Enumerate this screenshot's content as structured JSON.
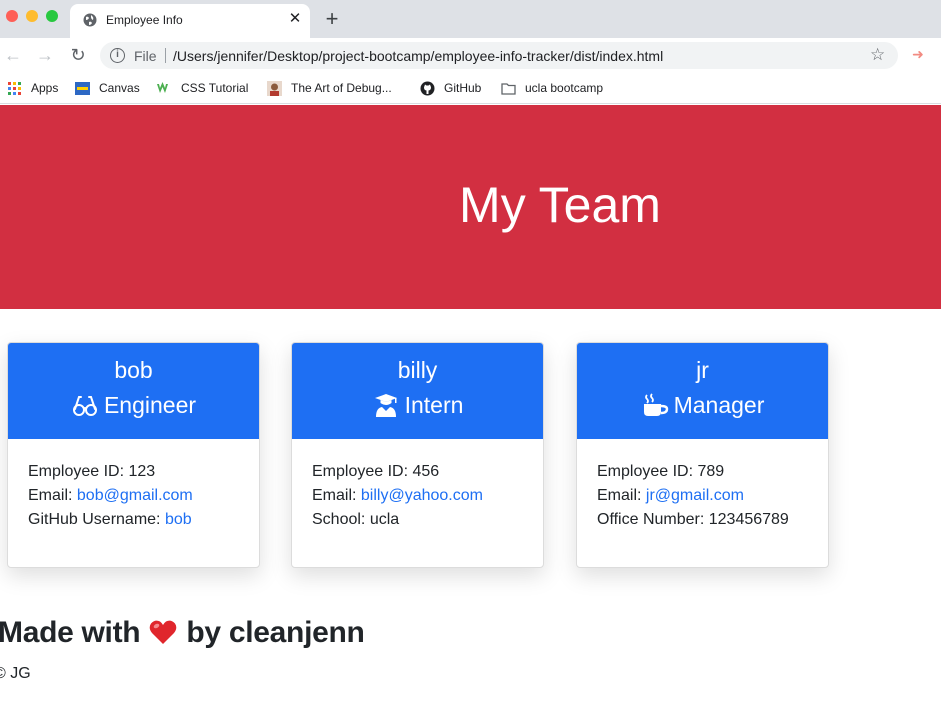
{
  "browser": {
    "tab_title": "Employee Info",
    "tab_close": "✕",
    "new_tab": "+",
    "file_label": "File",
    "url": "/Users/jennifer/Desktop/project-bootcamp/employee-info-tracker/dist/index.html",
    "bookmarks": [
      {
        "label": "Apps",
        "icon": "apps-grid-icon"
      },
      {
        "label": "Canvas",
        "icon": "ucla-icon"
      },
      {
        "label": "CSS Tutorial",
        "icon": "w3schools-icon"
      },
      {
        "label": "The Art of Debug...",
        "icon": "avatar-icon"
      },
      {
        "label": "GitHub",
        "icon": "github-icon"
      },
      {
        "label": "ucla bootcamp",
        "icon": "folder-icon"
      }
    ]
  },
  "header": {
    "title": "My Team"
  },
  "employees": [
    {
      "name": "bob",
      "role": "Engineer",
      "role_icon": "glasses-icon",
      "id_label": "Employee ID: 123",
      "email_label": "Email: ",
      "email": "bob@gmail.com",
      "extra_label": "GitHub Username: ",
      "extra_value": "bob"
    },
    {
      "name": "billy",
      "role": "Intern",
      "role_icon": "graduate-icon",
      "id_label": "Employee ID: 456",
      "email_label": "Email: ",
      "email": "billy@yahoo.com",
      "extra_label": "School: ucla",
      "extra_value": ""
    },
    {
      "name": "jr",
      "role": "Manager",
      "role_icon": "mug-icon",
      "id_label": "Employee ID: 789",
      "email_label": "Email: ",
      "email": "jr@gmail.com",
      "extra_label": "Office Number: 123456789",
      "extra_value": ""
    }
  ],
  "footer": {
    "made_with_prefix": "Made with",
    "made_with_suffix": "by cleanjenn",
    "copyright": "© JG"
  },
  "colors": {
    "header_bg": "#d22f41",
    "card_header_bg": "#1e6ff3",
    "link": "#1e6ff3"
  }
}
